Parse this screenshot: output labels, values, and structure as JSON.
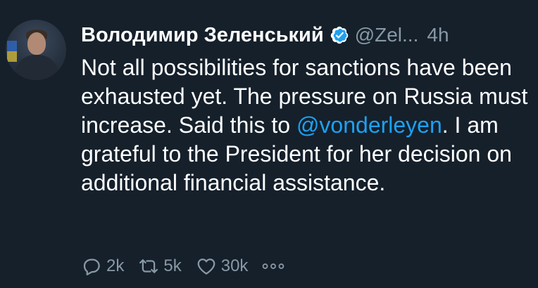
{
  "author": {
    "name": "Володимир Зеленський",
    "handle": "@Zel...",
    "time": "4h",
    "verified_icon": "verified-badge-icon"
  },
  "tweet": {
    "text_before_mention": "Not all possibilities for sanctions have been exhausted yet. The pressure on Russia must increase. Said this to ",
    "mention": "@vonderleyen",
    "text_after_mention": ". I am grateful to the President for her decision on additional financial assistance."
  },
  "actions": {
    "replies": "2k",
    "retweets": "5k",
    "likes": "30k"
  },
  "colors": {
    "background": "#15202b",
    "text": "#ffffff",
    "muted": "#8899a6",
    "accent": "#1da1f2"
  }
}
